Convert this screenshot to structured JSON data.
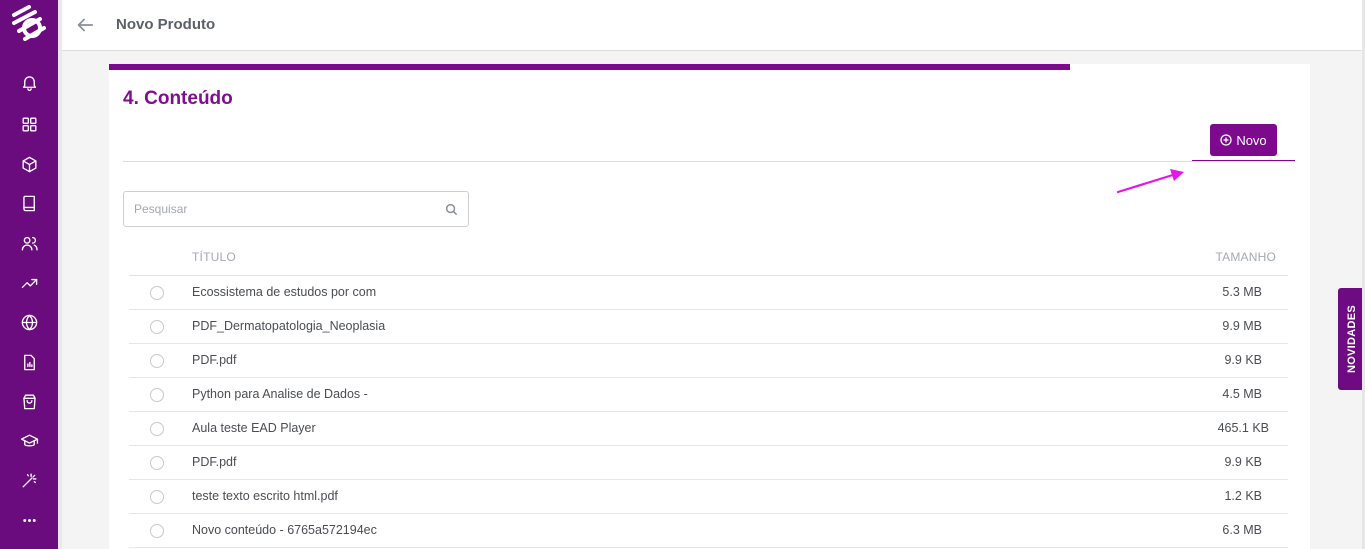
{
  "header": {
    "title": "Novo Produto"
  },
  "sidebar": {
    "items": [
      {
        "icon": "bell-icon"
      },
      {
        "icon": "grid-icon"
      },
      {
        "icon": "box-icon"
      },
      {
        "icon": "book-icon"
      },
      {
        "icon": "users-icon"
      },
      {
        "icon": "trending-up-icon"
      },
      {
        "icon": "globe-icon"
      },
      {
        "icon": "report-icon"
      },
      {
        "icon": "shopping-bag-icon"
      },
      {
        "icon": "graduation-cap-icon"
      },
      {
        "icon": "magic-wand-icon"
      },
      {
        "icon": "more-icon"
      }
    ]
  },
  "content": {
    "section_title": "4. Conteúdo",
    "step_progress_fraction": 0.8,
    "new_button_label": "Novo",
    "search_placeholder": "Pesquisar",
    "columns": {
      "title": "TÍTULO",
      "size": "TAMANHO"
    },
    "rows": [
      {
        "title": "Ecossistema de estudos por com",
        "size": "5.3 MB"
      },
      {
        "title": "PDF_Dermatopatologia_Neoplasia",
        "size": "9.9 MB"
      },
      {
        "title": "PDF.pdf",
        "size": "9.9 KB"
      },
      {
        "title": "Python para Analise de Dados -",
        "size": "4.5 MB"
      },
      {
        "title": "Aula teste EAD Player",
        "size": "465.1 KB"
      },
      {
        "title": "PDF.pdf",
        "size": "9.9 KB"
      },
      {
        "title": "teste texto escrito html.pdf",
        "size": "1.2 KB"
      },
      {
        "title": "Novo conteúdo - 6765a572194ec",
        "size": "6.3 MB"
      }
    ]
  },
  "news_tab": {
    "label": "NOVIDADES"
  },
  "colors": {
    "brand": "#6a0b7e",
    "accent": "#7d0a8c",
    "annotation": "#e815e8"
  }
}
